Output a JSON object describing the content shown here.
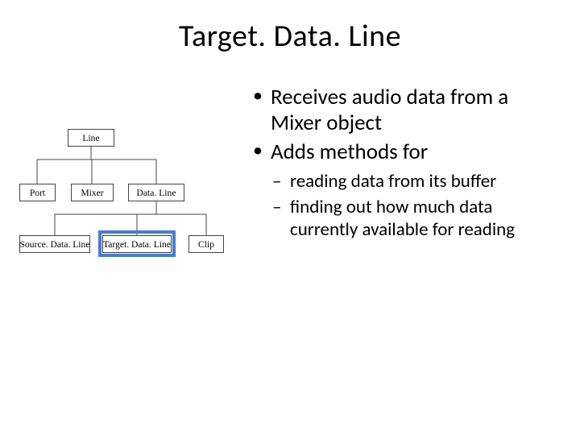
{
  "title": "Target. Data. Line",
  "bullets": [
    {
      "text": "Receives audio data from a Mixer object"
    },
    {
      "text": "Adds methods for",
      "sub": [
        "reading data from its buffer",
        "finding out how much data currently available for reading"
      ]
    }
  ],
  "diagram": {
    "boxes": {
      "line": "Line",
      "port": "Port",
      "mixer": "Mixer",
      "dataline": "Data. Line",
      "source": "Source. Data. Line",
      "target": "Target. Data. Line",
      "clip": "Clip"
    },
    "highlighted": "target"
  }
}
